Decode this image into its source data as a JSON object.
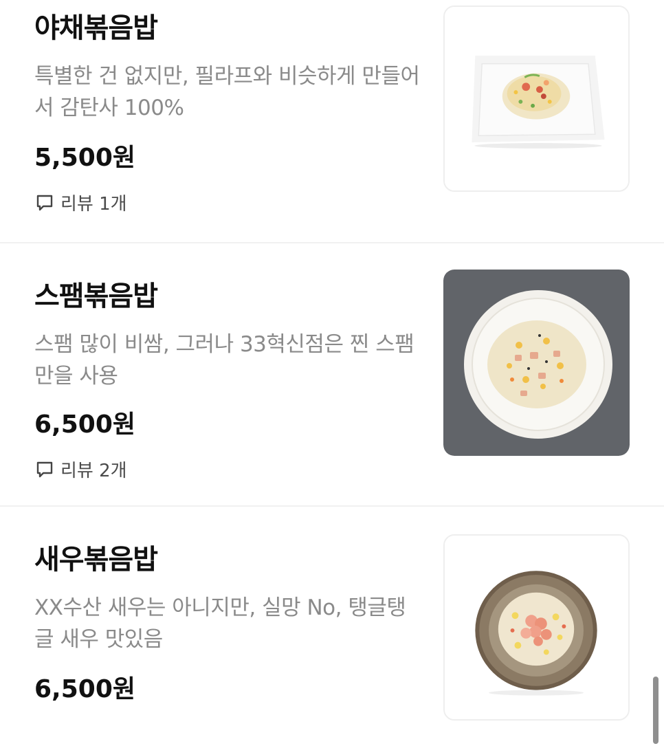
{
  "menu": {
    "items": [
      {
        "name": "야채볶음밥",
        "description": "특별한 건 없지만, 필라프와 비슷하게 만들어서 감탄사 100%",
        "price": "5,500원",
        "review": "리뷰 1개",
        "image_icon": "vegetable-fried-rice-photo"
      },
      {
        "name": "스팸볶음밥",
        "description": "스팸 많이 비쌈, 그러나 33혁신점은 찐 스팸만을 사용",
        "price": "6,500원",
        "review": "리뷰 2개",
        "image_icon": "spam-fried-rice-photo"
      },
      {
        "name": "새우볶음밥",
        "description": "XX수산 새우는 아니지만, 실망 No, 탱글탱글 새우 맛있음",
        "price": "6,500원",
        "image_icon": "shrimp-fried-rice-photo"
      }
    ]
  },
  "colors": {
    "text_primary": "#111111",
    "text_secondary": "#8a8a8a",
    "divider": "#f1f1f1",
    "scrollbar": "#8f8f8f"
  }
}
